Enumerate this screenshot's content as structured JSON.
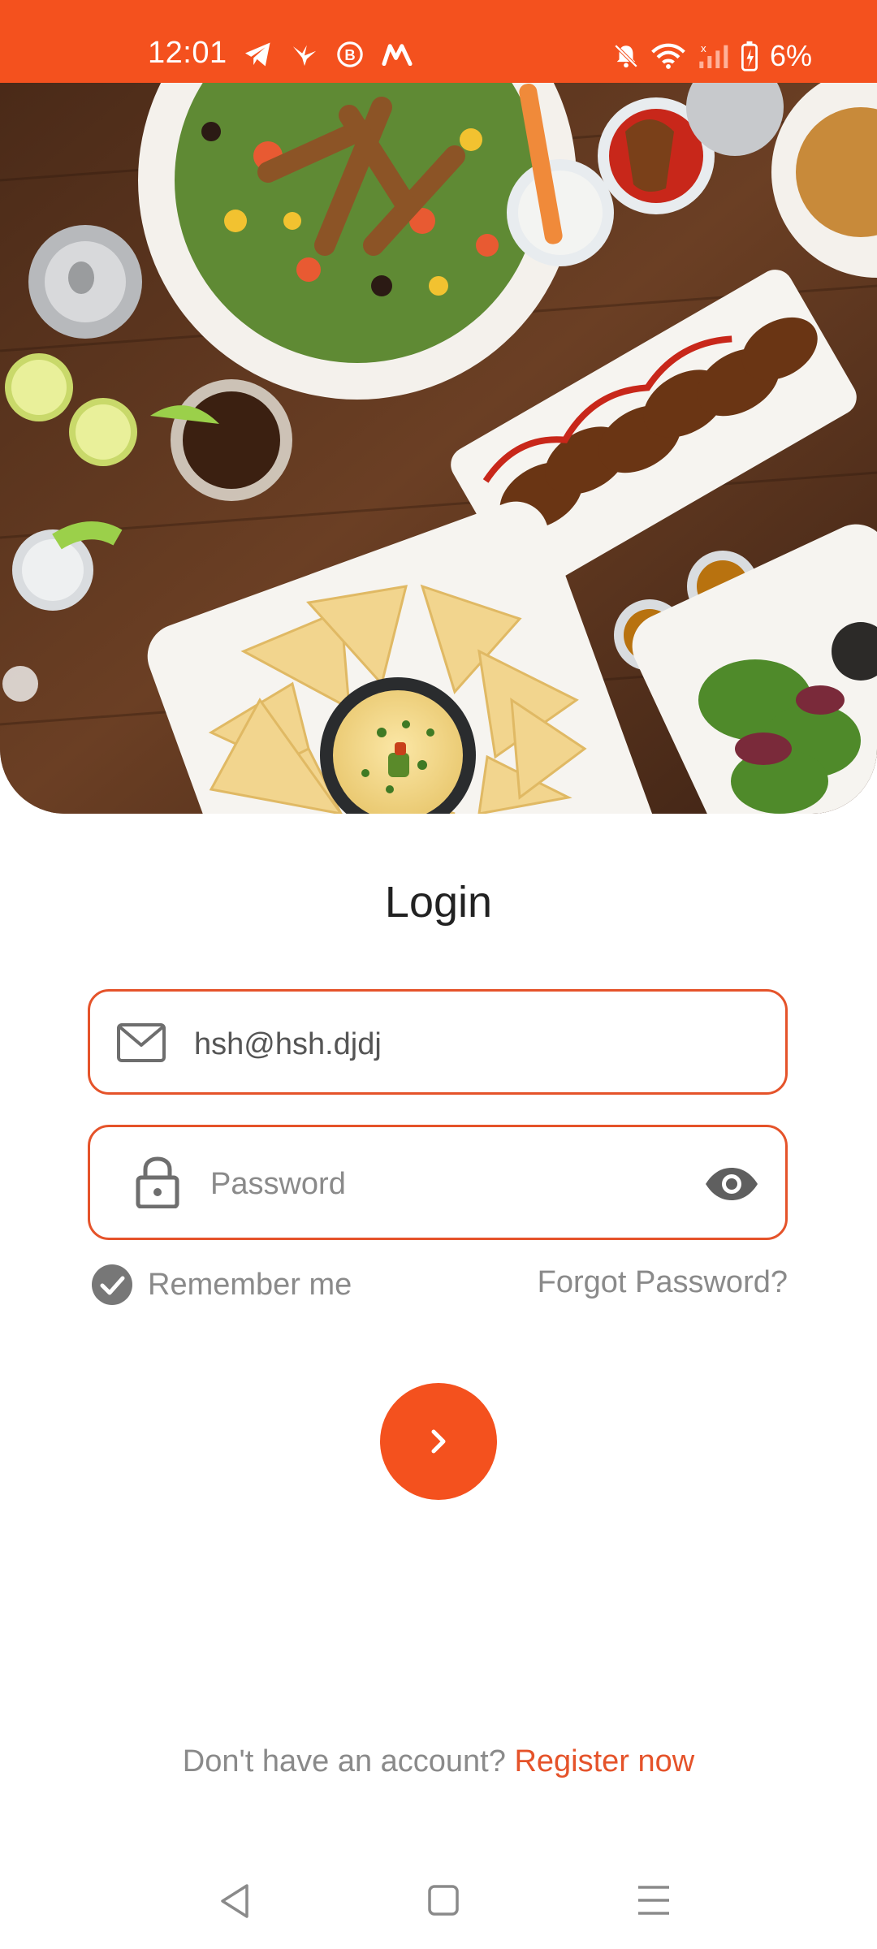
{
  "status_bar": {
    "time": "12:01",
    "battery_percent": "6%",
    "left_icons": [
      "telegram-icon",
      "bird-icon",
      "b-circle-icon",
      "m-logo-icon"
    ],
    "right_icons": [
      "bell-muted-icon",
      "wifi-icon",
      "signal-icon",
      "battery-charging-icon"
    ],
    "color": "#f4511e"
  },
  "hero": {
    "image": "food-table-photo"
  },
  "login": {
    "title": "Login",
    "email": {
      "value": "hsh@hsh.djdj",
      "icon": "mail-icon"
    },
    "password": {
      "placeholder": "Password",
      "value": "",
      "icon": "lock-icon",
      "toggle_icon": "eye-icon"
    },
    "remember_me": {
      "label": "Remember me",
      "checked": true
    },
    "forgot_password": "Forgot Password?",
    "submit_icon": "chevron-right-icon",
    "accent_color": "#e5532a"
  },
  "register": {
    "prompt": "Don't have an account? ",
    "link": "Register now"
  },
  "nav_bar": {
    "buttons": [
      "back-icon",
      "home-icon",
      "menu-icon"
    ]
  }
}
